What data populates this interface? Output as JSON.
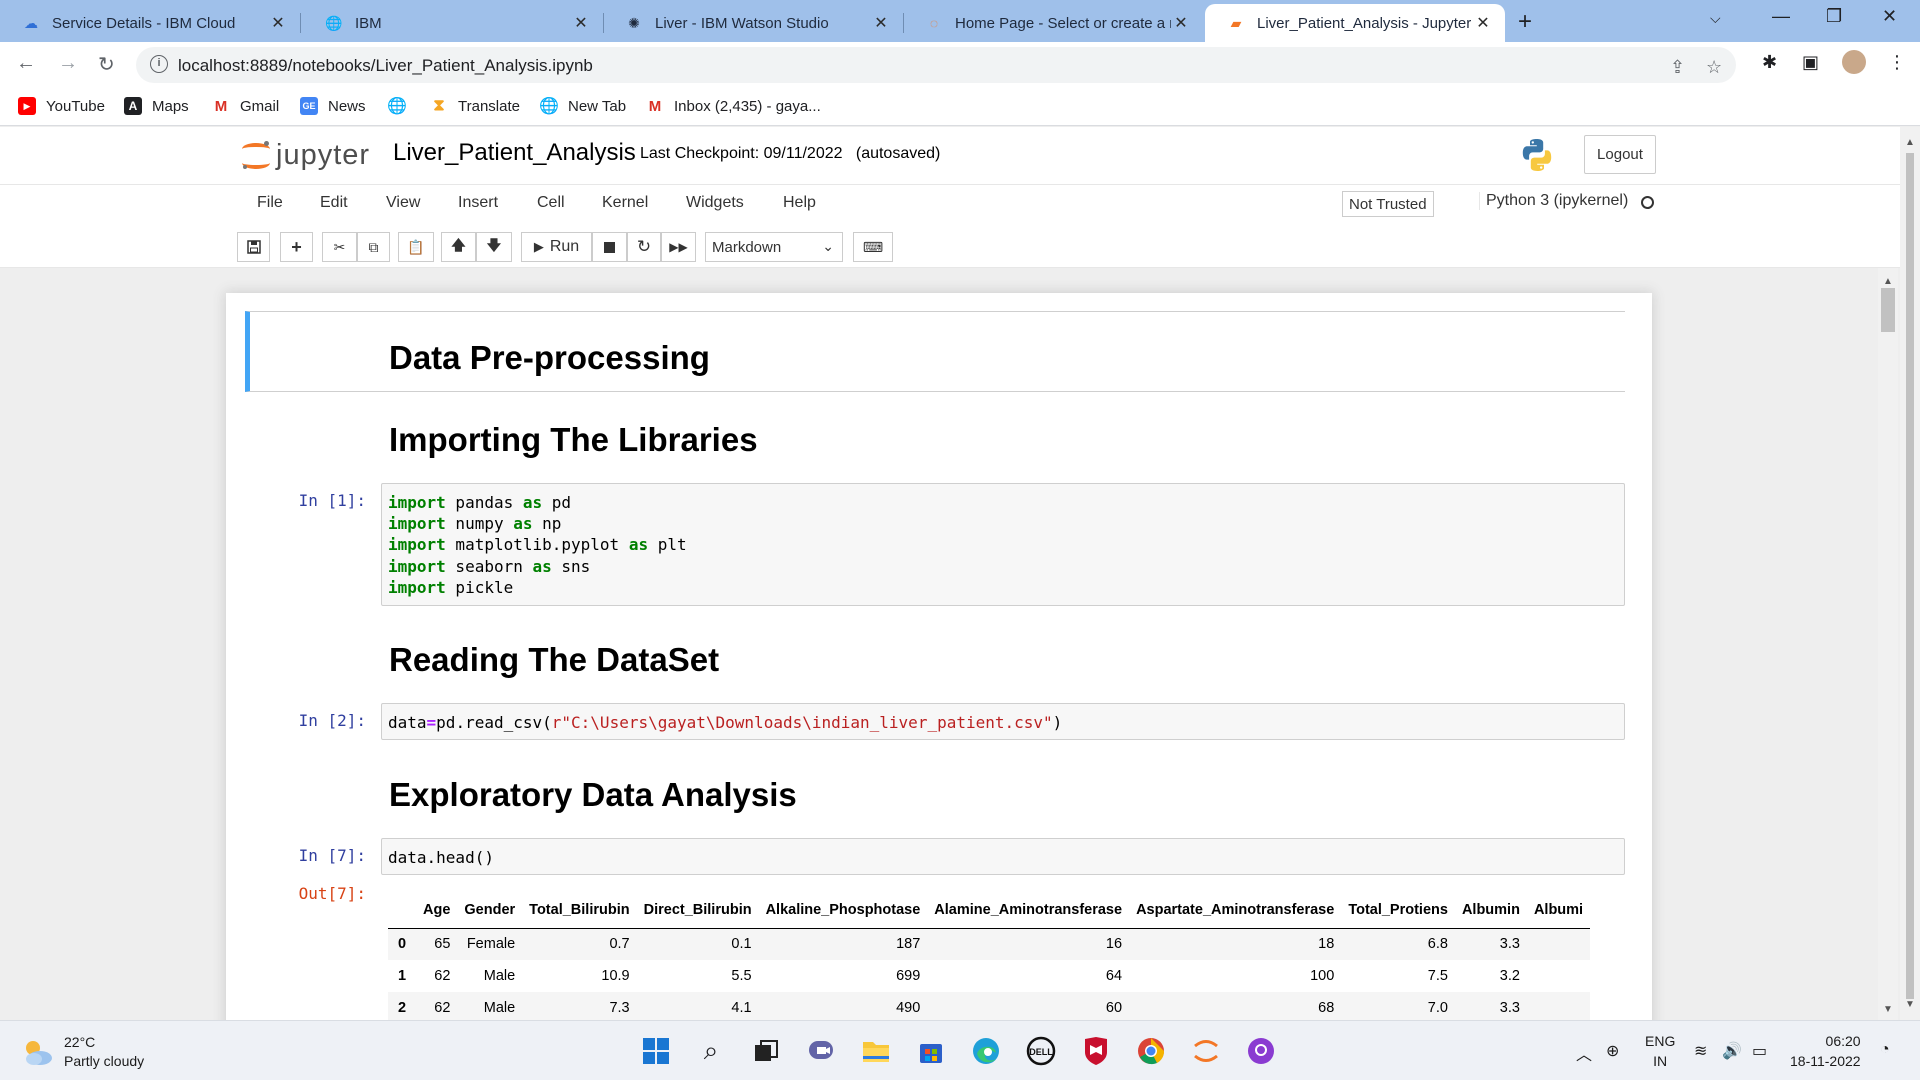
{
  "browser": {
    "tabs": [
      {
        "title": "Service Details - IBM Cloud",
        "icon": "cloud-icon"
      },
      {
        "title": "IBM",
        "icon": "globe-icon"
      },
      {
        "title": "Liver - IBM Watson Studio",
        "icon": "watson-icon"
      },
      {
        "title": "Home Page - Select or create a n",
        "icon": "jupyter-icon"
      },
      {
        "title": "Liver_Patient_Analysis - Jupyter N",
        "icon": "notebook-icon",
        "active": true
      }
    ],
    "url": "localhost:8889/notebooks/Liver_Patient_Analysis.ipynb",
    "bookmarks": [
      "YouTube",
      "Maps",
      "Gmail",
      "News",
      "Translate",
      "New Tab",
      "Inbox (2,435) - gaya..."
    ]
  },
  "jupyter": {
    "logo_text": "jupyter",
    "notebook_name": "Liver_Patient_Analysis",
    "checkpoint": "Last Checkpoint: 09/11/2022",
    "autosave": "(autosaved)",
    "logout": "Logout",
    "menu": [
      "File",
      "Edit",
      "View",
      "Insert",
      "Cell",
      "Kernel",
      "Widgets",
      "Help"
    ],
    "trust": "Not Trusted",
    "kernel": "Python 3 (ipykernel)",
    "toolbar": {
      "run_label": "Run",
      "cell_type": "Markdown"
    }
  },
  "cells": {
    "h_preprocessing": "Data Pre-processing",
    "h_import": "Importing The Libraries",
    "in1_prompt": "In [1]:",
    "h_reading": "Reading The DataSet",
    "in2_prompt": "In [2]:",
    "h_eda": "Exploratory Data Analysis",
    "in7_prompt": "In [7]:",
    "in7_code": "data.head()",
    "out7_prompt": "Out[7]:"
  },
  "dataframe": {
    "columns": [
      "",
      "Age",
      "Gender",
      "Total_Bilirubin",
      "Direct_Bilirubin",
      "Alkaline_Phosphotase",
      "Alamine_Aminotransferase",
      "Aspartate_Aminotransferase",
      "Total_Protiens",
      "Albumin",
      "Albumi"
    ],
    "rows": [
      [
        "0",
        "65",
        "Female",
        "0.7",
        "0.1",
        "187",
        "16",
        "18",
        "6.8",
        "3.3",
        ""
      ],
      [
        "1",
        "62",
        "Male",
        "10.9",
        "5.5",
        "699",
        "64",
        "100",
        "7.5",
        "3.2",
        ""
      ],
      [
        "2",
        "62",
        "Male",
        "7.3",
        "4.1",
        "490",
        "60",
        "68",
        "7.0",
        "3.3",
        ""
      ]
    ]
  },
  "taskbar": {
    "temperature": "22°C",
    "weather": "Partly cloudy",
    "lang1": "ENG",
    "lang2": "IN",
    "time": "06:20",
    "date": "18-11-2022"
  }
}
